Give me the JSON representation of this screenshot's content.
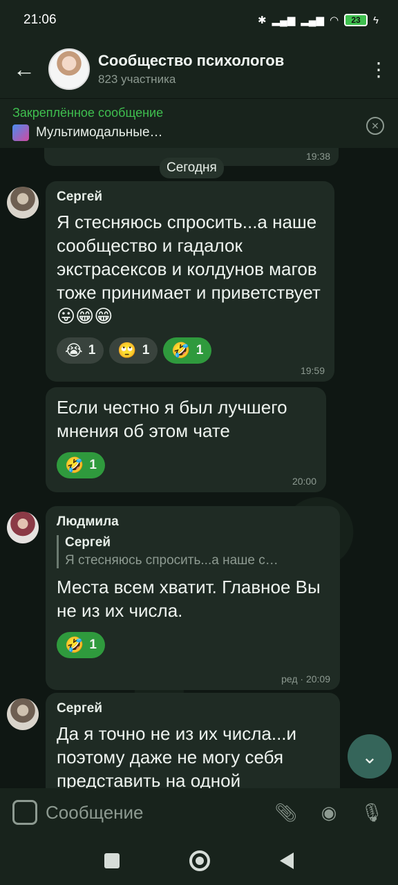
{
  "status_bar": {
    "time": "21:06",
    "battery": "23",
    "icons": [
      "bluetooth-icon",
      "signal-icon",
      "signal-icon",
      "wifi-icon",
      "battery-icon",
      "charging-icon"
    ]
  },
  "header": {
    "title": "Сообщество психологов",
    "subtitle": "823 участника"
  },
  "pinned": {
    "label": "Закреплённое сообщение",
    "text": "Мультимодальные…"
  },
  "chat": {
    "previous_time": "19:38",
    "date_chip": "Сегодня",
    "messages": [
      {
        "sender": "Сергей",
        "text": "Я стесняюсь спросить...а наше сообщество и гадалок экстрасексов и колдунов магов тоже принимает и приветствует 😛😁😁",
        "reactions": [
          {
            "emoji": "😭",
            "count": "1",
            "active": false
          },
          {
            "emoji": "🙄",
            "count": "1",
            "active": false
          },
          {
            "emoji": "🤣",
            "count": "1",
            "active": true
          }
        ],
        "time": "19:59"
      },
      {
        "text": "Если честно я был лучшего мнения об этом чате",
        "reactions": [
          {
            "emoji": "🤣",
            "count": "1",
            "active": true
          }
        ],
        "time": "20:00"
      },
      {
        "sender": "Людмила",
        "reply": {
          "name": "Сергей",
          "text": "Я стесняюсь спросить...а наше с…"
        },
        "text": "Места всем хватит. Главное Вы не из их числа.",
        "reactions": [
          {
            "emoji": "🤣",
            "count": "1",
            "active": true
          }
        ],
        "time": "ред · 20:09"
      },
      {
        "sender": "Сергей",
        "text": "Да я точно не из их числа...и поэтому даже не могу себя представить на одной"
      }
    ]
  },
  "input": {
    "placeholder": "Сообщение"
  }
}
